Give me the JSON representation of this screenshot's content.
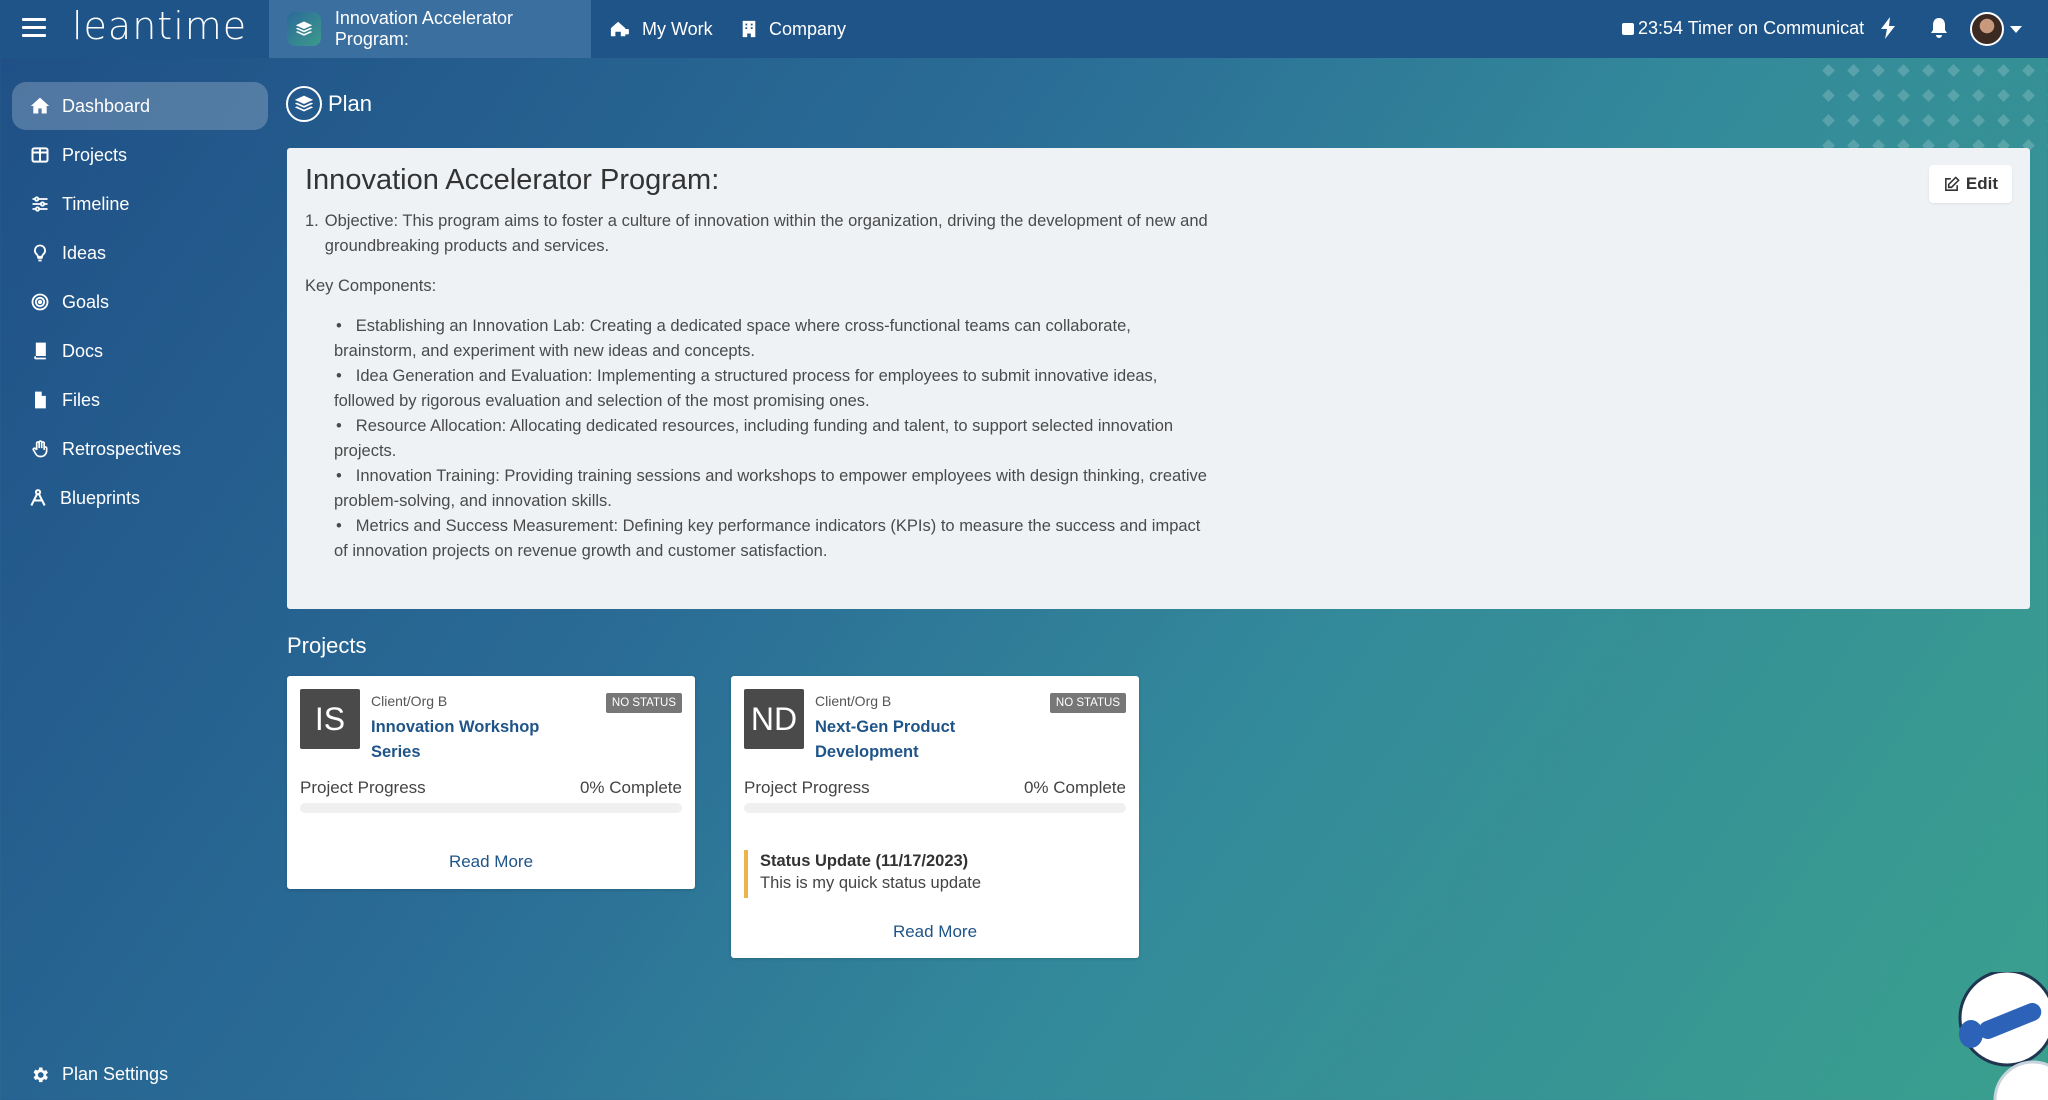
{
  "app": {
    "logo": "leantime"
  },
  "topbar": {
    "current_project": "Innovation Accelerator Program:",
    "my_work": "My Work",
    "company": "Company",
    "timer": "23:54 Timer on Communicat"
  },
  "sidebar": {
    "items": [
      {
        "label": "Dashboard",
        "icon": "home-icon"
      },
      {
        "label": "Projects",
        "icon": "columns-icon"
      },
      {
        "label": "Timeline",
        "icon": "sliders-icon"
      },
      {
        "label": "Ideas",
        "icon": "lightbulb-icon"
      },
      {
        "label": "Goals",
        "icon": "target-icon"
      },
      {
        "label": "Docs",
        "icon": "book-icon"
      },
      {
        "label": "Files",
        "icon": "file-icon"
      },
      {
        "label": "Retrospectives",
        "icon": "hand-icon"
      },
      {
        "label": "Blueprints",
        "icon": "compass-icon"
      }
    ],
    "settings_label": "Plan Settings"
  },
  "page": {
    "heading": "Plan",
    "title": "Innovation Accelerator Program:",
    "edit_label": "Edit",
    "objective_num": "1.",
    "objective": "Objective: This program aims to foster a culture of innovation within the organization, driving the development of new and groundbreaking products and services.",
    "key_components_label": "Key Components:",
    "components": [
      "Establishing an Innovation Lab: Creating a dedicated space where cross-functional teams can collaborate, brainstorm, and experiment with new ideas and concepts.",
      "Idea Generation and Evaluation: Implementing a structured process for employees to submit innovative ideas, followed by rigorous evaluation and selection of the most promising ones.",
      "Resource Allocation: Allocating dedicated resources, including funding and talent, to support selected innovation projects.",
      "Innovation Training: Providing training sessions and workshops to empower employees with design thinking, creative problem-solving, and innovation skills.",
      "Metrics and Success Measurement: Defining key performance indicators (KPIs) to measure the success and impact of innovation projects on revenue growth and customer satisfaction."
    ],
    "projects_heading": "Projects"
  },
  "projects": [
    {
      "initials": "IS",
      "client": "Client/Org B",
      "name": "Innovation Workshop Series",
      "status": "NO STATUS",
      "progress_label": "Project Progress",
      "progress_text": "0% Complete",
      "progress_fraction": 0,
      "read_more": "Read More"
    },
    {
      "initials": "ND",
      "client": "Client/Org B",
      "name": "Next-Gen Product Development",
      "status": "NO STATUS",
      "progress_label": "Project Progress",
      "progress_text": "0% Complete",
      "progress_fraction": 0,
      "status_update_title": "Status Update (11/17/2023)",
      "status_update_text": "This is my quick status update",
      "read_more": "Read More"
    }
  ]
}
